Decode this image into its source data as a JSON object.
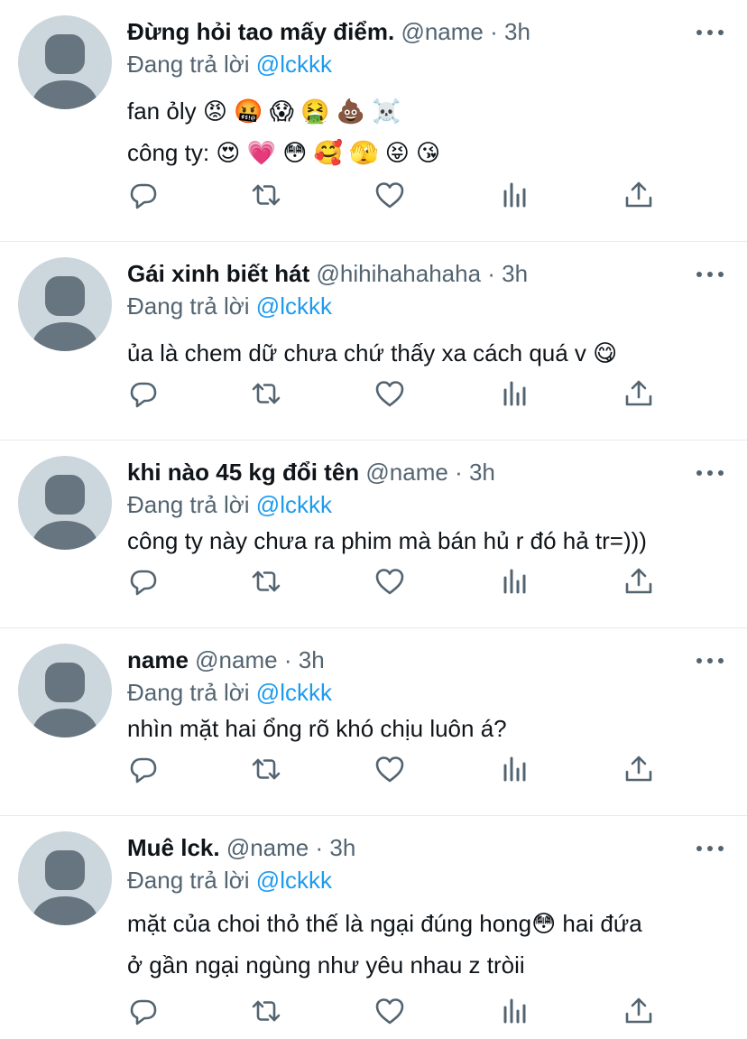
{
  "tweets": [
    {
      "name": "Đừng hỏi tao mấy điểm.",
      "handle": "@name",
      "time": "3h",
      "reply_label": "Đang trả lời",
      "reply_mention": "@lckkk",
      "lines": [
        "fan ỏly 😡 🤬 😱 🤮 💩 ☠️",
        "công ty: 😍 💗 😳 🥰 🫣 😝 😘"
      ]
    },
    {
      "name": "Gái xinh biết hát",
      "handle": "@hihihahahaha",
      "time": "3h",
      "reply_label": "Đang trả lời",
      "reply_mention": "@lckkk",
      "lines": [
        "ủa là chem dữ chưa chứ thấy xa cách quá v 😋"
      ]
    },
    {
      "name": "khi nào 45 kg đổi tên",
      "handle": "@name",
      "time": "3h",
      "reply_label": "Đang trả lời",
      "reply_mention": "@lckkk",
      "lines": [
        "công ty này chưa ra phim mà bán hủ r đó hả tr=)))"
      ]
    },
    {
      "name": "name",
      "handle": "@name",
      "time": "3h",
      "reply_label": "Đang trả lời",
      "reply_mention": "@lckkk",
      "lines": [
        "nhìn mặt hai ổng rõ khó chịu luôn á?"
      ]
    },
    {
      "name": "Muê lck.",
      "handle": "@name",
      "time": "3h",
      "reply_label": "Đang trả lời",
      "reply_mention": "@lckkk",
      "lines": [
        "mặt của choi thỏ thế là ngại đúng hong😳  hai đứa",
        "ở gần ngại ngùng như yêu nhau z tròii"
      ]
    }
  ],
  "separator_dot": "·",
  "icons": [
    "reply-icon",
    "retweet-icon",
    "like-icon",
    "analytics-icon",
    "share-icon",
    "more-icon",
    "avatar-icon"
  ],
  "colors": {
    "text": "#0f1419",
    "secondary": "#536471",
    "mention": "#1d9bf0",
    "avatar_bg": "#ccd6dd",
    "avatar_fg": "#66757f",
    "divider": "#e6ecf0"
  }
}
